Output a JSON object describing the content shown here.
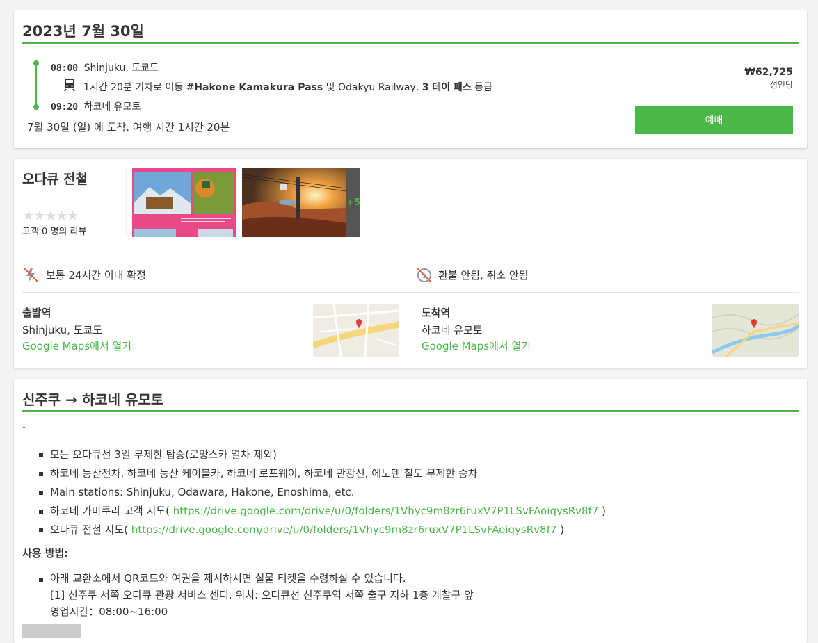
{
  "trip": {
    "date_title": "2023년 7월 30일",
    "depart_time": "08:00",
    "depart_station": "Shinjuku, 도쿄도",
    "transfer": {
      "duration": "1시간 20분 기차로 이동",
      "pass_name": "#Hakone Kamakura Pass",
      "conj": "및",
      "railway": "Odakyu Railway,",
      "pass_days": "3 데이 패스",
      "grade": "등급"
    },
    "arrive_time": "09:20",
    "arrive_station": "하코네 유모토",
    "arrival_summary": "7월 30일 (일) 에 도착. 여행 시간 1시간 20분",
    "price": "₩62,725",
    "price_unit": "성인당",
    "book_label": "예매"
  },
  "operator": {
    "name": "오다큐 전철",
    "stars": 0,
    "reviews": "고객 0 명의 리뷰",
    "more_photos": "+5",
    "feature1": "보통 24시간 이내 확정",
    "feature2": "환불 안됨, 취소 안됨"
  },
  "stations": {
    "from_head": "출발역",
    "from_name": "Shinjuku, 도쿄도",
    "from_link": "Google Maps에서 열기",
    "to_head": "도착역",
    "to_name": "하코네 유모토",
    "to_link": "Google Maps에서 열기"
  },
  "details": {
    "title": "신주쿠 → 하코네 유모토",
    "dash": "-",
    "bullets": [
      "모든 오다큐선 3일 무제한 탑승(로망스카 열차 제외)",
      "하코네 등산전차, 하코네 등산 케이블카, 하코네 로프웨이, 하코네 관광선, 에노덴 철도 무제한 승차",
      "Main stations: Shinjuku, Odawara, Hakone, Enoshima, etc."
    ],
    "map1_label": "하코네 가마쿠라 고객 지도(",
    "map1_url": "https://drive.google.com/drive/u/0/folders/1Vhyc9m8zr6ruxV7P1LSvFAoiqysRv8f7",
    "map1_close": ")",
    "map2_label": "오다큐 전철 지도(",
    "map2_url": "https://drive.google.com/drive/u/0/folders/1Vhyc9m8zr6ruxV7P1LSvFAoiqysRv8f7",
    "map2_close": ")",
    "usage_title": "사용 방법:",
    "usage_line1": "아래 교환소에서 QR코드와 여권을 제시하시면 실물 티켓을 수령하실 수 있습니다.",
    "usage_line2": "[1] 신주쿠 서쪽 오다큐 관광 서비스 센터. 위치: 오다큐선 신주쿠역 서쪽 출구 지하 1층 개찰구 앞",
    "usage_line3": "영업시간：08:00~16:00"
  },
  "colors": {
    "accent": "#4cb749",
    "text": "#333333"
  },
  "icons": [
    "train-icon",
    "no-instant-confirm-icon",
    "no-refund-icon",
    "star-icon",
    "map-pin-icon"
  ]
}
